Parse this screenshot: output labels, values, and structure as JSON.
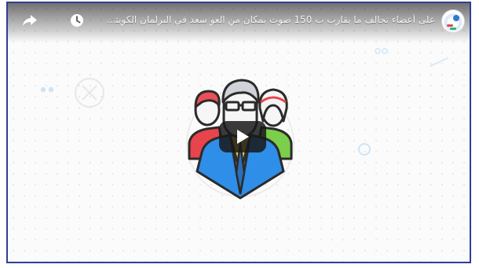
{
  "video": {
    "title": "على أعضاء تحالف ما يقارب ب 150 صوت بمكان من العو سعد في البرلمان الكويتي !!! #أطلق_الأصوات"
  },
  "icons": {
    "share": "share-icon",
    "watch_later": "watch-later-icon",
    "play": "play-icon",
    "channel_avatar": "channel-avatar"
  },
  "colors": {
    "frame_border": "#2f3e96",
    "play_bg": "#191919",
    "accent_blue": "#2e79d3",
    "accent_red": "#d94b4b",
    "accent_green": "#2bb673",
    "accent_yellow": "#f4d03f"
  }
}
